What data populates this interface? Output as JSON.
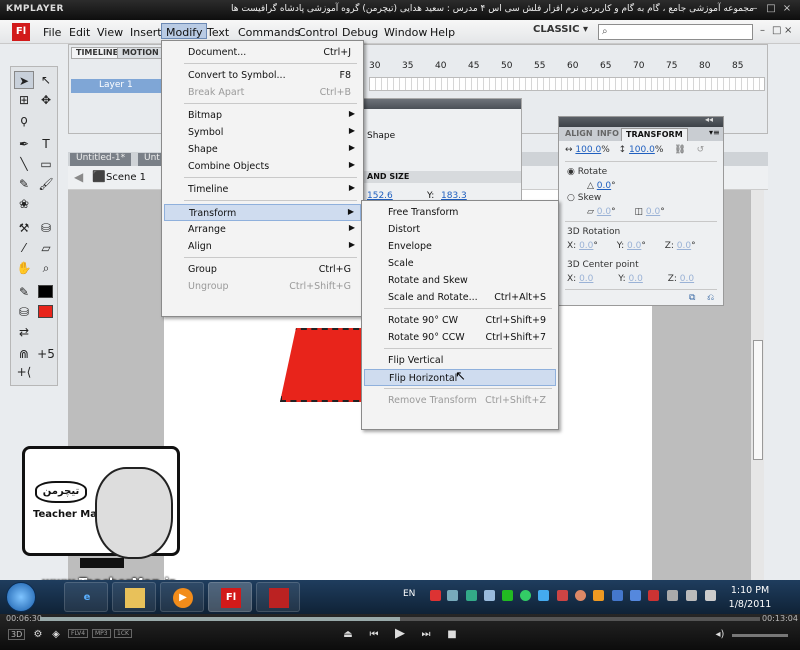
{
  "player": {
    "app_name": "KMPLAYER",
    "caption": "مجموعه آموزشی جامع ، گام به گام و کاربردی نرم افزار فلش سی اس ۴ مدرس : سعید هدایی (تیچرمن) گروه آموزشی پادشاه گرافیست ها",
    "time_elapsed": "00:06:30",
    "time_total": "00:13:04",
    "progress": 0.5,
    "badges": [
      "FLV4",
      "MP3",
      "1CK"
    ],
    "mode_3d": "3D"
  },
  "app": {
    "logo": "Fl",
    "menu": [
      "File",
      "Edit",
      "View",
      "Insert",
      "Modify",
      "Text",
      "Commands",
      "Control",
      "Debug",
      "Window",
      "Help"
    ],
    "active_menu": "Modify",
    "workspace": "CLASSIC",
    "search_value": "",
    "search_icon": "magnifier-icon"
  },
  "timeline": {
    "tabs": [
      "TIMELINE",
      "MOTION ED"
    ],
    "layer": "Layer 1",
    "frame_numbers": [
      "30",
      "35",
      "40",
      "45",
      "50",
      "55",
      "60",
      "65",
      "70",
      "75",
      "80",
      "85"
    ]
  },
  "document": {
    "tabs": [
      "Untitled-1*",
      "Unt"
    ],
    "scene": "Scene 1"
  },
  "modify_menu": {
    "items": [
      {
        "label": "Document...",
        "shortcut": "Ctrl+J",
        "disabled": false,
        "submenu": false
      },
      {
        "sep": true
      },
      {
        "label": "Convert to Symbol...",
        "shortcut": "F8",
        "disabled": false,
        "submenu": false
      },
      {
        "label": "Break Apart",
        "shortcut": "Ctrl+B",
        "disabled": true,
        "submenu": false
      },
      {
        "sep": true
      },
      {
        "label": "Bitmap",
        "shortcut": "",
        "disabled": false,
        "submenu": true
      },
      {
        "label": "Symbol",
        "shortcut": "",
        "disabled": false,
        "submenu": true
      },
      {
        "label": "Shape",
        "shortcut": "",
        "disabled": false,
        "submenu": true
      },
      {
        "label": "Combine Objects",
        "shortcut": "",
        "disabled": false,
        "submenu": true
      },
      {
        "sep": true
      },
      {
        "label": "Timeline",
        "shortcut": "",
        "disabled": false,
        "submenu": true
      },
      {
        "sep": true
      },
      {
        "label": "Transform",
        "shortcut": "",
        "disabled": false,
        "submenu": true,
        "highlight": true
      },
      {
        "label": "Arrange",
        "shortcut": "",
        "disabled": false,
        "submenu": true
      },
      {
        "label": "Align",
        "shortcut": "",
        "disabled": false,
        "submenu": true
      },
      {
        "sep": true
      },
      {
        "label": "Group",
        "shortcut": "Ctrl+G",
        "disabled": false,
        "submenu": false
      },
      {
        "label": "Ungroup",
        "shortcut": "Ctrl+Shift+G",
        "disabled": true,
        "submenu": false
      }
    ]
  },
  "transform_menu": {
    "items": [
      {
        "label": "Free Transform",
        "shortcut": "",
        "disabled": false
      },
      {
        "label": "Distort",
        "shortcut": "",
        "disabled": false
      },
      {
        "label": "Envelope",
        "shortcut": "",
        "disabled": false
      },
      {
        "label": "Scale",
        "shortcut": "",
        "disabled": false
      },
      {
        "label": "Rotate and Skew",
        "shortcut": "",
        "disabled": false
      },
      {
        "label": "Scale and Rotate...",
        "shortcut": "Ctrl+Alt+S",
        "disabled": false
      },
      {
        "sep": true
      },
      {
        "label": "Rotate 90° CW",
        "shortcut": "Ctrl+Shift+9",
        "disabled": false
      },
      {
        "label": "Rotate 90° CCW",
        "shortcut": "Ctrl+Shift+7",
        "disabled": false
      },
      {
        "sep": true
      },
      {
        "label": "Flip Vertical",
        "shortcut": "",
        "disabled": false
      },
      {
        "label": "Flip Horizontal",
        "shortcut": "",
        "disabled": false,
        "highlight": true
      },
      {
        "sep": true
      },
      {
        "label": "Remove Transform",
        "shortcut": "Ctrl+Shift+Z",
        "disabled": true
      }
    ]
  },
  "properties": {
    "shape_label": "Shape",
    "section": "AND SIZE",
    "x_value": "152.6",
    "y_label": "Y:",
    "y_value": "183.3"
  },
  "transform_panel": {
    "tabs": [
      "ALIGN",
      "INFO",
      "TRANSFORM"
    ],
    "width_pct": "100.0",
    "height_pct": "100.0",
    "pct_sign": "%",
    "rotate_label": "Rotate",
    "rotate_value": "0.0",
    "skew_label": "Skew",
    "skew_h": "0.0",
    "skew_v": "0.0",
    "deg": "°",
    "rot3d_label": "3D Rotation",
    "center3d_label": "3D Center point",
    "x_label": "X:",
    "y_label": "Y:",
    "z_label": "Z:",
    "rot3d": [
      "0.0",
      "0.0",
      "0.0"
    ],
    "center3d": [
      "0.0",
      "0.0",
      "0.0"
    ]
  },
  "watermark": {
    "brand_fa": "تیچرمن",
    "brand_en": "Teacher Man",
    "url": "www.TeacherMan.ir"
  },
  "taskbar": {
    "lang": "EN",
    "time": "1:10 PM",
    "date": "1/8/2011",
    "apps": [
      "ie-icon",
      "explorer-icon",
      "media-player-icon",
      "flash-icon",
      "teacherman-app-icon"
    ],
    "fl_label": "Fl"
  }
}
